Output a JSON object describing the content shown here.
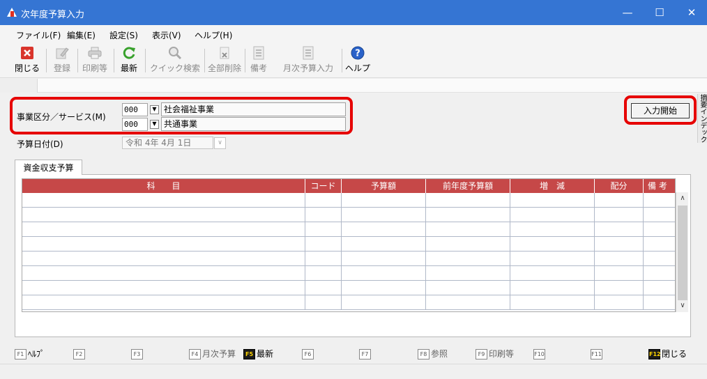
{
  "window": {
    "title": "次年度予算入力",
    "minimize": "—",
    "maximize": "☐",
    "close": "✕"
  },
  "menu": [
    "ファイル(F)",
    "編集(E)",
    "設定(S)",
    "表示(V)",
    "ヘルプ(H)"
  ],
  "toolbar": {
    "close": "閉じる",
    "register": "登録",
    "print": "印刷等",
    "refresh": "最新",
    "quick_search": "クイック検索",
    "delete_all": "全部削除",
    "notes": "備考",
    "monthly_budget": "月次予算入力",
    "help": "ヘルプ"
  },
  "form": {
    "service_label": "事業区分／サービス(M)",
    "service_code_1": "000",
    "service_name_1": "社会福祉事業",
    "service_code_2": "000",
    "service_name_2": "共通事業",
    "date_label": "予算日付(D)",
    "date_value": "令和  4年  4月  1日",
    "start_button": "入力開始",
    "side_tab": "摘要インデックス"
  },
  "tab": "資金収支予算",
  "table": {
    "columns": [
      "科　　目",
      "コード",
      "予算額",
      "前年度予算額",
      "増　減",
      "配分",
      "備 考"
    ]
  },
  "fkeys": [
    {
      "key": "F1",
      "label": "ﾍﾙﾌﾟ"
    },
    {
      "key": "F2",
      "label": ""
    },
    {
      "key": "F3",
      "label": ""
    },
    {
      "key": "F4",
      "label": "月次予算"
    },
    {
      "key": "F5",
      "label": "最新"
    },
    {
      "key": "F6",
      "label": ""
    },
    {
      "key": "F7",
      "label": ""
    },
    {
      "key": "F8",
      "label": "参照"
    },
    {
      "key": "F9",
      "label": "印刷等"
    },
    {
      "key": "F10",
      "label": ""
    },
    {
      "key": "F11",
      "label": ""
    },
    {
      "key": "F12",
      "label": "閉じる"
    }
  ],
  "colors": {
    "title_bar": "#3575d3",
    "table_header": "#c64848",
    "highlight": "#e60000"
  }
}
